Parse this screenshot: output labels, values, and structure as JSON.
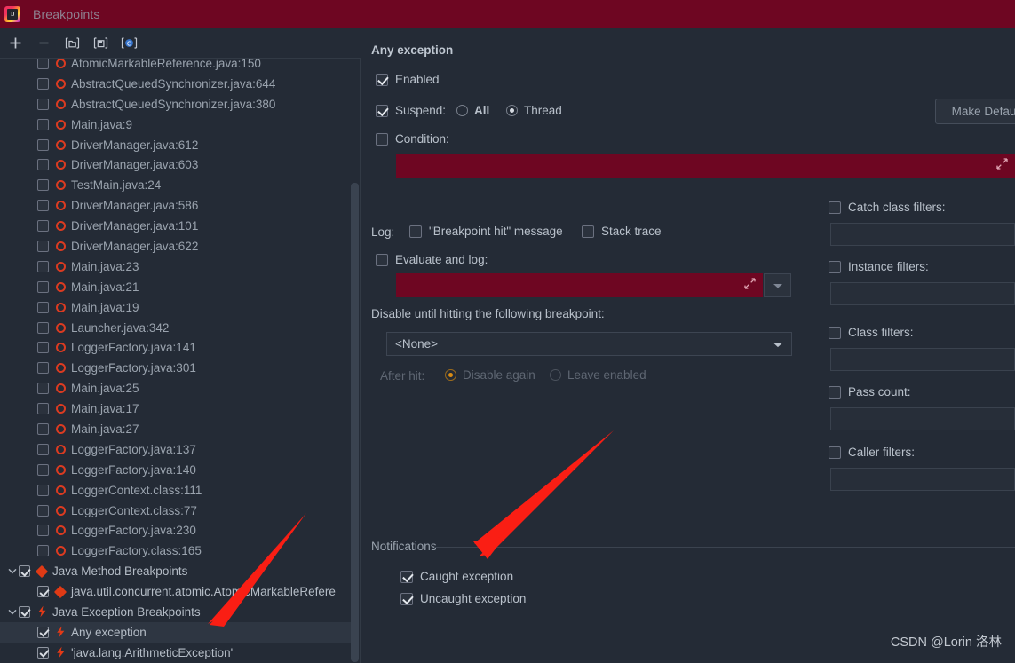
{
  "window": {
    "title": "Breakpoints",
    "icon": "intellij-idea-logo-icon",
    "titlebar_color": "#6e0622",
    "background_color": "#242b36"
  },
  "toolbar": {
    "add_label": "+",
    "remove_label": "−",
    "icons": [
      "add-icon",
      "remove-icon",
      "group-folder-icon",
      "save-to-file-icon",
      "class-breakpoint-icon"
    ]
  },
  "tree": {
    "items": [
      {
        "label": "AtomicMarkableReference.java:150",
        "checked": false,
        "icon": "breakpoint-ring-icon",
        "indent": 1,
        "selected": false,
        "expander": null
      },
      {
        "label": "AbstractQueuedSynchronizer.java:644",
        "checked": false,
        "icon": "breakpoint-ring-icon",
        "indent": 1,
        "selected": false,
        "expander": null
      },
      {
        "label": "AbstractQueuedSynchronizer.java:380",
        "checked": false,
        "icon": "breakpoint-ring-icon",
        "indent": 1,
        "selected": false,
        "expander": null
      },
      {
        "label": "Main.java:9",
        "checked": false,
        "icon": "breakpoint-ring-icon",
        "indent": 1,
        "selected": false,
        "expander": null
      },
      {
        "label": "DriverManager.java:612",
        "checked": false,
        "icon": "breakpoint-ring-icon",
        "indent": 1,
        "selected": false,
        "expander": null
      },
      {
        "label": "DriverManager.java:603",
        "checked": false,
        "icon": "breakpoint-ring-icon",
        "indent": 1,
        "selected": false,
        "expander": null
      },
      {
        "label": "TestMain.java:24",
        "checked": false,
        "icon": "breakpoint-ring-icon",
        "indent": 1,
        "selected": false,
        "expander": null
      },
      {
        "label": "DriverManager.java:586",
        "checked": false,
        "icon": "breakpoint-ring-icon",
        "indent": 1,
        "selected": false,
        "expander": null
      },
      {
        "label": "DriverManager.java:101",
        "checked": false,
        "icon": "breakpoint-ring-icon",
        "indent": 1,
        "selected": false,
        "expander": null
      },
      {
        "label": "DriverManager.java:622",
        "checked": false,
        "icon": "breakpoint-ring-icon",
        "indent": 1,
        "selected": false,
        "expander": null
      },
      {
        "label": "Main.java:23",
        "checked": false,
        "icon": "breakpoint-ring-icon",
        "indent": 1,
        "selected": false,
        "expander": null
      },
      {
        "label": "Main.java:21",
        "checked": false,
        "icon": "breakpoint-ring-icon",
        "indent": 1,
        "selected": false,
        "expander": null
      },
      {
        "label": "Main.java:19",
        "checked": false,
        "icon": "breakpoint-ring-icon",
        "indent": 1,
        "selected": false,
        "expander": null
      },
      {
        "label": "Launcher.java:342",
        "checked": false,
        "icon": "breakpoint-ring-icon",
        "indent": 1,
        "selected": false,
        "expander": null
      },
      {
        "label": "LoggerFactory.java:141",
        "checked": false,
        "icon": "breakpoint-ring-icon",
        "indent": 1,
        "selected": false,
        "expander": null
      },
      {
        "label": "LoggerFactory.java:301",
        "checked": false,
        "icon": "breakpoint-ring-icon",
        "indent": 1,
        "selected": false,
        "expander": null
      },
      {
        "label": "Main.java:25",
        "checked": false,
        "icon": "breakpoint-ring-icon",
        "indent": 1,
        "selected": false,
        "expander": null
      },
      {
        "label": "Main.java:17",
        "checked": false,
        "icon": "breakpoint-ring-icon",
        "indent": 1,
        "selected": false,
        "expander": null
      },
      {
        "label": "Main.java:27",
        "checked": false,
        "icon": "breakpoint-ring-icon",
        "indent": 1,
        "selected": false,
        "expander": null
      },
      {
        "label": "LoggerFactory.java:137",
        "checked": false,
        "icon": "breakpoint-ring-icon",
        "indent": 1,
        "selected": false,
        "expander": null
      },
      {
        "label": "LoggerFactory.java:140",
        "checked": false,
        "icon": "breakpoint-ring-icon",
        "indent": 1,
        "selected": false,
        "expander": null
      },
      {
        "label": "LoggerContext.class:111",
        "checked": false,
        "icon": "breakpoint-ring-icon",
        "indent": 1,
        "selected": false,
        "expander": null
      },
      {
        "label": "LoggerContext.class:77",
        "checked": false,
        "icon": "breakpoint-ring-icon",
        "indent": 1,
        "selected": false,
        "expander": null
      },
      {
        "label": "LoggerFactory.java:230",
        "checked": false,
        "icon": "breakpoint-ring-icon",
        "indent": 1,
        "selected": false,
        "expander": null
      },
      {
        "label": "LoggerFactory.class:165",
        "checked": false,
        "icon": "breakpoint-ring-icon",
        "indent": 1,
        "selected": false,
        "expander": null
      },
      {
        "label": "Java Method Breakpoints",
        "checked": true,
        "icon": "method-breakpoint-diamond-icon",
        "indent": 0,
        "selected": false,
        "expander": "expanded"
      },
      {
        "label": "java.util.concurrent.atomic.AtomicMarkableRefere",
        "checked": true,
        "icon": "method-breakpoint-diamond-icon",
        "indent": 1,
        "selected": false,
        "expander": null
      },
      {
        "label": "Java Exception Breakpoints",
        "checked": true,
        "icon": "exception-breakpoint-bolt-icon",
        "indent": 0,
        "selected": false,
        "expander": "expanded"
      },
      {
        "label": "Any exception",
        "checked": true,
        "icon": "exception-breakpoint-bolt-icon",
        "indent": 1,
        "selected": true,
        "expander": null
      },
      {
        "label": "'java.lang.ArithmeticException'",
        "checked": true,
        "icon": "exception-breakpoint-bolt-icon",
        "indent": 1,
        "selected": false,
        "expander": null
      }
    ]
  },
  "detail": {
    "title": "Any exception",
    "enabled": {
      "label": "Enabled",
      "checked": true
    },
    "suspend": {
      "label": "Suspend:",
      "checked": true,
      "options": [
        {
          "label": "All",
          "selected": false
        },
        {
          "label": "Thread",
          "selected": true
        }
      ]
    },
    "condition": {
      "label": "Condition:",
      "checked": false,
      "value": "",
      "expand_icon": "expand-editor-icon"
    },
    "log": {
      "label": "Log:",
      "breakpoint_hit": {
        "label": "\"Breakpoint hit\" message",
        "checked": false
      },
      "stack_trace": {
        "label": "Stack trace",
        "checked": false
      }
    },
    "evaluate_and_log": {
      "label": "Evaluate and log:",
      "checked": false,
      "value": "",
      "expand_icon": "expand-editor-icon",
      "dropdown_icon": "chevron-down-icon"
    },
    "disable_until": {
      "label": "Disable until hitting the following breakpoint:",
      "selected_value": "<None>",
      "caret_icon": "chevron-down-icon"
    },
    "after_hit": {
      "label": "After hit:",
      "disabled": true,
      "options": [
        {
          "label": "Disable again",
          "selected": true
        },
        {
          "label": "Leave enabled",
          "selected": false
        }
      ]
    },
    "make_default_button": "Make Defau",
    "filters": [
      {
        "label": "Catch class filters:",
        "checked": false,
        "value": ""
      },
      {
        "label": "Instance filters:",
        "checked": false,
        "value": ""
      },
      {
        "label": "Class filters:",
        "checked": false,
        "value": ""
      },
      {
        "label": "Pass count:",
        "checked": false,
        "value": ""
      },
      {
        "label": "Caller filters:",
        "checked": false,
        "value": ""
      }
    ],
    "notifications": {
      "title": "Notifications",
      "items": [
        {
          "label": "Caught exception",
          "checked": true
        },
        {
          "label": "Uncaught exception",
          "checked": true
        }
      ]
    }
  },
  "annotations": {
    "arrow_color": "#fa1e14",
    "watermark": "CSDN @Lorin 洛林"
  }
}
